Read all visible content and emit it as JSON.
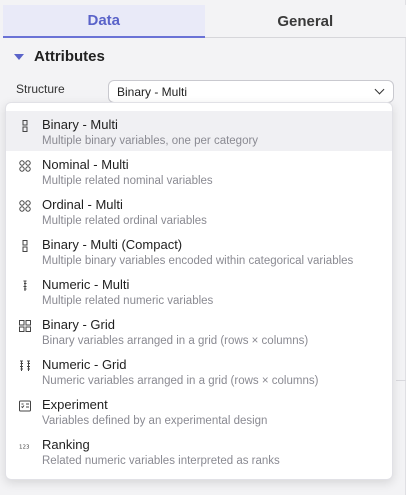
{
  "tabs": [
    {
      "label": "Data",
      "active": true
    },
    {
      "label": "General",
      "active": false
    }
  ],
  "section": {
    "title": "Attributes"
  },
  "structure": {
    "label": "Structure",
    "value": "Binary - Multi"
  },
  "dropdown": {
    "options": [
      {
        "title": "Binary - Multi",
        "desc": "Multiple binary variables, one per category",
        "icon": "binary-multi-icon",
        "selected": true
      },
      {
        "title": "Nominal - Multi",
        "desc": "Multiple related nominal variables",
        "icon": "nominal-multi-icon",
        "selected": false
      },
      {
        "title": "Ordinal - Multi",
        "desc": "Multiple related ordinal variables",
        "icon": "ordinal-multi-icon",
        "selected": false
      },
      {
        "title": "Binary - Multi (Compact)",
        "desc": "Multiple binary variables encoded within categorical variables",
        "icon": "binary-compact-icon",
        "selected": false
      },
      {
        "title": "Numeric - Multi",
        "desc": "Multiple related numeric variables",
        "icon": "numeric-multi-icon",
        "selected": false
      },
      {
        "title": "Binary - Grid",
        "desc": "Binary variables arranged in a grid (rows × columns)",
        "icon": "binary-grid-icon",
        "selected": false
      },
      {
        "title": "Numeric - Grid",
        "desc": "Numeric variables arranged in a grid (rows × columns)",
        "icon": "numeric-grid-icon",
        "selected": false
      },
      {
        "title": "Experiment",
        "desc": "Variables defined by an experimental design",
        "icon": "experiment-icon",
        "selected": false
      },
      {
        "title": "Ranking",
        "desc": "Related numeric variables interpreted as ranks",
        "icon": "ranking-icon",
        "selected": false
      }
    ]
  },
  "colors": {
    "accent": "#5a63c9",
    "tab_active_bg": "#e9eaf8",
    "desc_text": "#8a8a92"
  }
}
